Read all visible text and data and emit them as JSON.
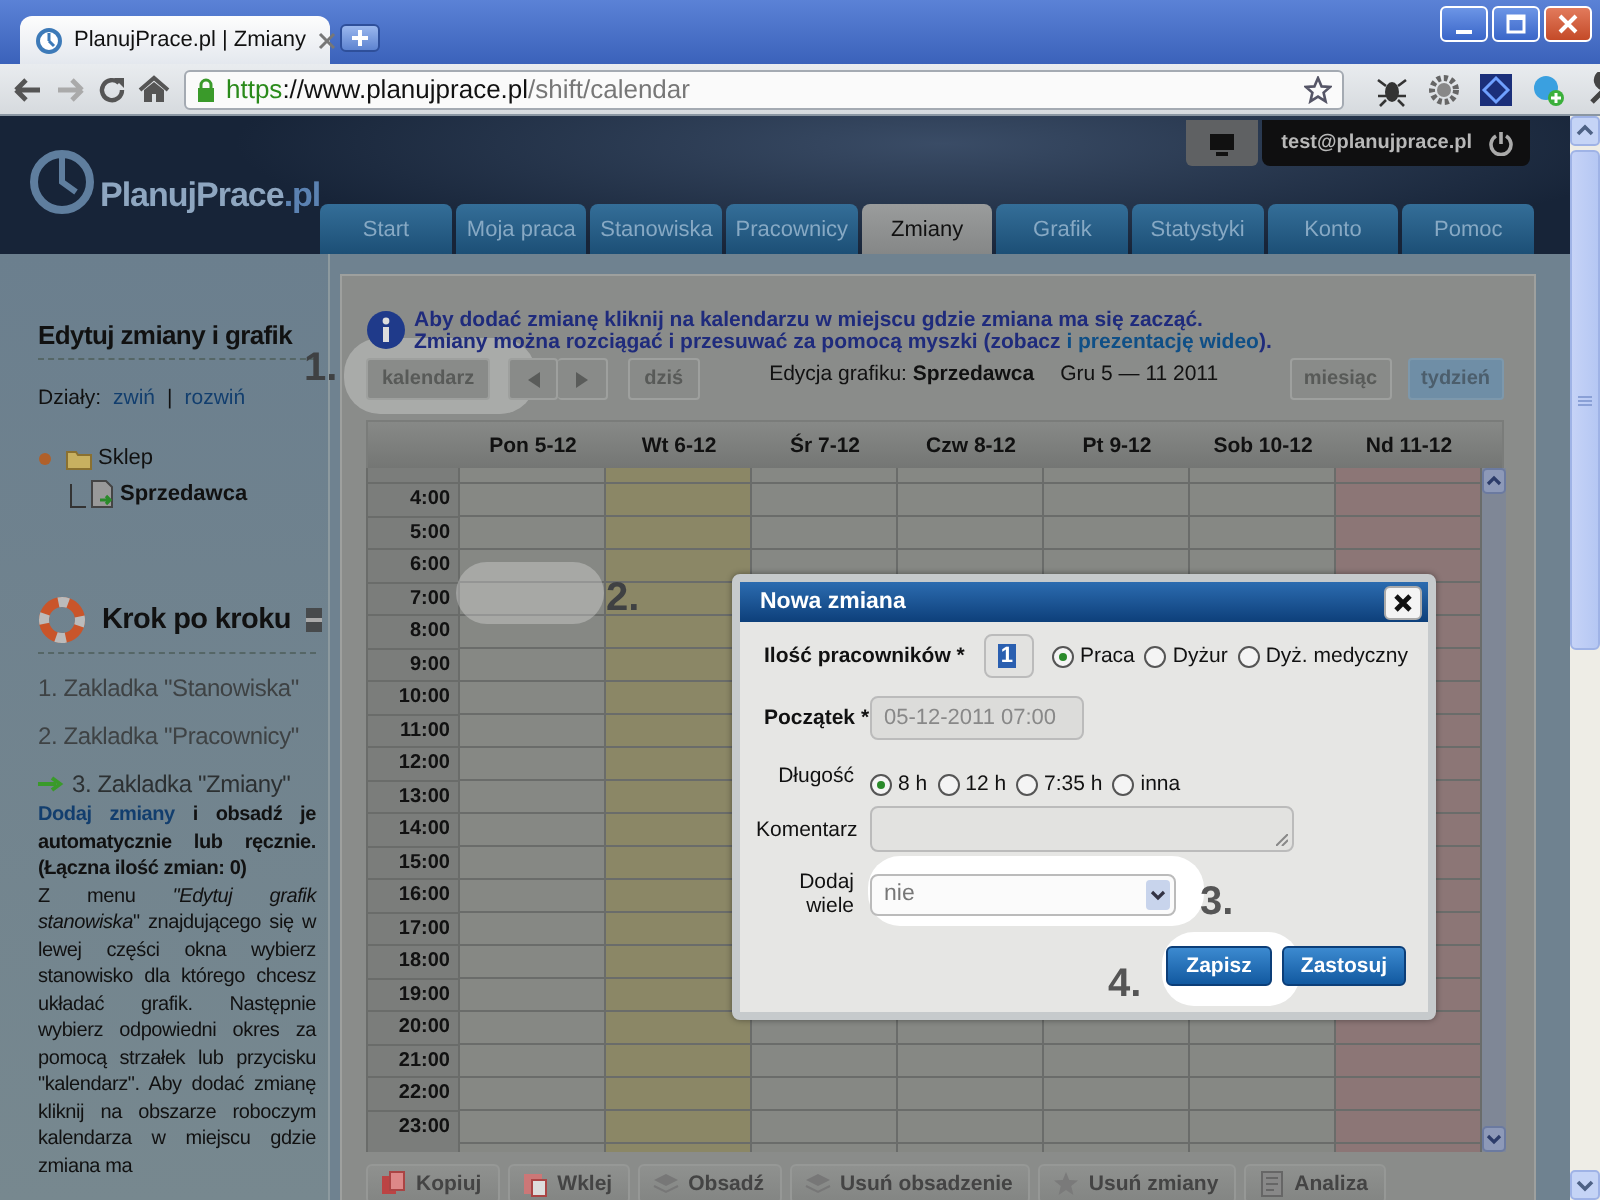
{
  "browser": {
    "tab_title": "PlanujPrace.pl | Zmiany",
    "url_parts": [
      {
        "kind": "scheme",
        "text": "https"
      },
      {
        "kind": "host",
        "text": "://www.planujprace.pl"
      },
      {
        "kind": "path",
        "text": "/shift/calendar"
      }
    ]
  },
  "header": {
    "logo": {
      "name": "PlanujPrace",
      "suffix": ".pl"
    },
    "account": "test@planujprace.pl",
    "nav": [
      {
        "label": "Start",
        "selected": false
      },
      {
        "label": "Moja praca",
        "selected": false
      },
      {
        "label": "Stanowiska",
        "selected": false
      },
      {
        "label": "Pracownicy",
        "selected": false
      },
      {
        "label": "Zmiany",
        "selected": true
      },
      {
        "label": "Grafik",
        "selected": false
      },
      {
        "label": "Statystyki",
        "selected": false
      },
      {
        "label": "Konto",
        "selected": false
      },
      {
        "label": "Pomoc",
        "selected": false
      }
    ]
  },
  "sidebar": {
    "title": "Edytuj zmiany i grafik",
    "departments_label": "Działy:",
    "collapse_link": "zwiń",
    "separator": "|",
    "expand_link": "rozwiń",
    "tree": [
      {
        "label": "Sklep",
        "kind": "folder",
        "children": [
          {
            "label": "Sprzedawca",
            "kind": "position"
          }
        ]
      }
    ],
    "guide": {
      "title": "Krok po kroku",
      "steps": [
        {
          "label": "1. Zakladka \"Stanowiska\"",
          "current": false
        },
        {
          "label": "2. Zakladka \"Pracownicy\"",
          "current": false
        },
        {
          "label": "3. Zakladka \"Zmiany\"",
          "current": true
        }
      ],
      "action_link": "Dodaj zmiany",
      "action_text": "i obsadź je automatycznie lub ręcznie. (Łączna ilość zmian: 0)",
      "description": "Z menu *\"Edytuj grafik stanowiska*\" znajdującego się w lewej części okna wybierz stanowisko dla którego chcesz układać grafik. Następnie wybierz odpowiedni okres za pomocą strzałek lub przycisku \"kalendarz\". Aby dodać zmianę kliknij na obszarze roboczym kalendarza w miejscu gdzie zmiana ma"
    }
  },
  "calendar": {
    "info_line_1": "Aby dodać zmianę kliknij na kalendarzu w miejscu gdzie zmiana ma się zacząć.",
    "info_line_2": "Zmiany można rozciągać i przesuwać za pomocą myszki (zobacz",
    "info_link": "i prezentację wideo",
    "info_line_2_end": ").",
    "calendar_button": "kalendarz",
    "today_button": "dziś",
    "schedule_label": "Edycja grafiku: **Sprzedawca**",
    "date_range": "Gru 5 — 11 2011",
    "views": [
      {
        "label": "miesiąc",
        "selected": false
      },
      {
        "label": "tydzień",
        "selected": true
      }
    ],
    "days": [
      {
        "label": "Pon 5-12",
        "kind": "normal"
      },
      {
        "label": "Wt 6-12",
        "kind": "today"
      },
      {
        "label": "Śr 7-12",
        "kind": "normal"
      },
      {
        "label": "Czw 8-12",
        "kind": "normal"
      },
      {
        "label": "Pt 9-12",
        "kind": "normal"
      },
      {
        "label": "Sob 10-12",
        "kind": "normal"
      },
      {
        "label": "Nd 11-12",
        "kind": "holiday"
      }
    ],
    "hours": [
      "4:00",
      "5:00",
      "6:00",
      "7:00",
      "8:00",
      "9:00",
      "10:00",
      "11:00",
      "12:00",
      "13:00",
      "14:00",
      "15:00",
      "16:00",
      "17:00",
      "18:00",
      "19:00",
      "20:00",
      "21:00",
      "22:00",
      "23:00"
    ],
    "actions": [
      "Kopiuj",
      "Wklej",
      "Obsadź",
      "Usuń obsadzenie",
      "Usuń zmiany",
      "Analiza"
    ]
  },
  "dialog": {
    "title": "Nowa zmiana",
    "count_label": "Ilość pracowników *",
    "count_value": "1",
    "types": [
      {
        "label": "Praca",
        "selected": true
      },
      {
        "label": "Dyżur",
        "selected": false
      },
      {
        "label": "Dyż. medyczny",
        "selected": false
      }
    ],
    "start_label": "Początek *",
    "start_value": "05-12-2011 07:00",
    "length_label": "Długość",
    "lengths": [
      {
        "label": "8 h",
        "selected": true
      },
      {
        "label": "12 h",
        "selected": false
      },
      {
        "label": "7:35 h",
        "selected": false
      },
      {
        "label": "inna",
        "selected": false
      }
    ],
    "comment_label": "Komentarz",
    "multiple_label": "Dodaj wiele",
    "multiple_value": "nie",
    "buttons": [
      "Zapisz",
      "Zastosuj"
    ]
  },
  "annotations": [
    "1.",
    "2.",
    "3.",
    "4."
  ]
}
